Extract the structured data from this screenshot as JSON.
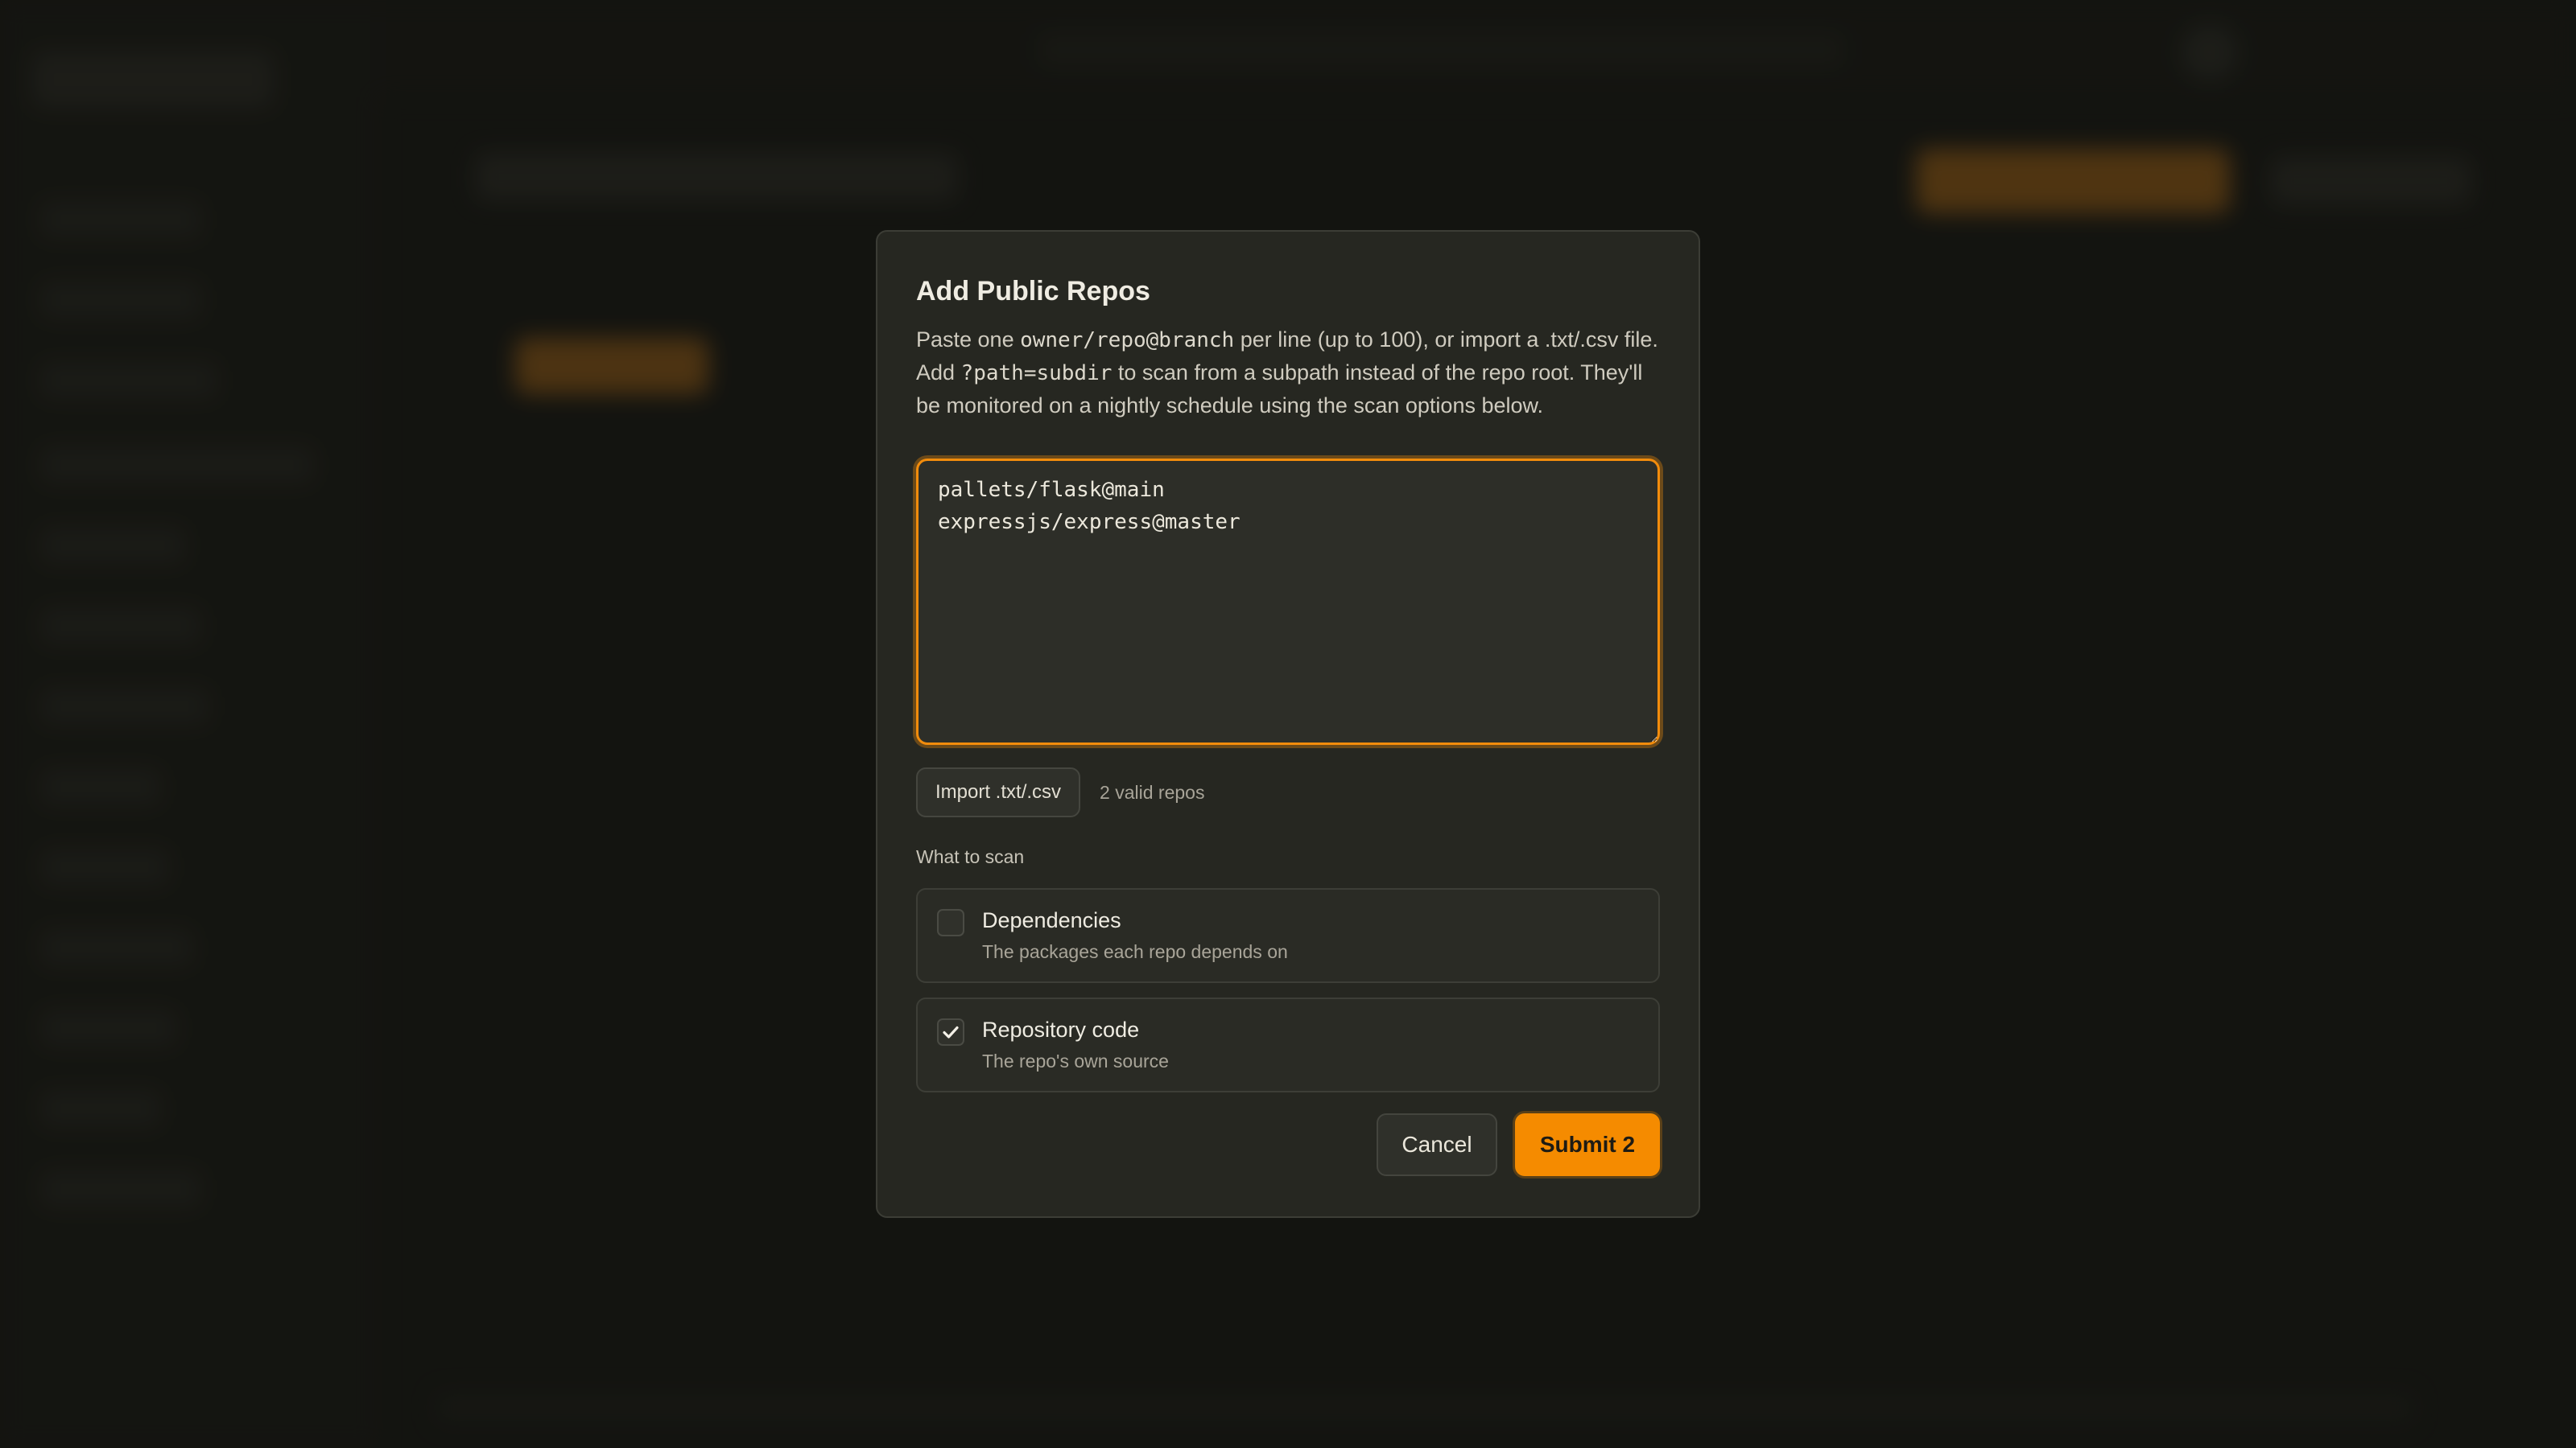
{
  "modal": {
    "title": "Add Public Repos",
    "description": {
      "part1": "Paste one ",
      "code1": "owner/repo@branch",
      "part2": " per line (up to 100), or import a .txt/.csv file. Add ",
      "code2": "?path=subdir",
      "part3": " to scan from a subpath instead of the repo root. They'll be monitored on a nightly schedule using the scan options below."
    },
    "textarea_value": "pallets/flask@main\nexpressjs/express@master",
    "import_button_label": "Import .txt/.csv",
    "valid_count": "2 valid repos",
    "section_label": "What to scan",
    "options": [
      {
        "title": "Dependencies",
        "description": "The packages each repo depends on",
        "checked": false
      },
      {
        "title": "Repository code",
        "description": "The repo's own source",
        "checked": true
      }
    ],
    "cancel_label": "Cancel",
    "submit_label": "Submit 2"
  },
  "colors": {
    "accent": "#f58b00",
    "background": "#1b1c17",
    "modal_background": "#262721"
  }
}
